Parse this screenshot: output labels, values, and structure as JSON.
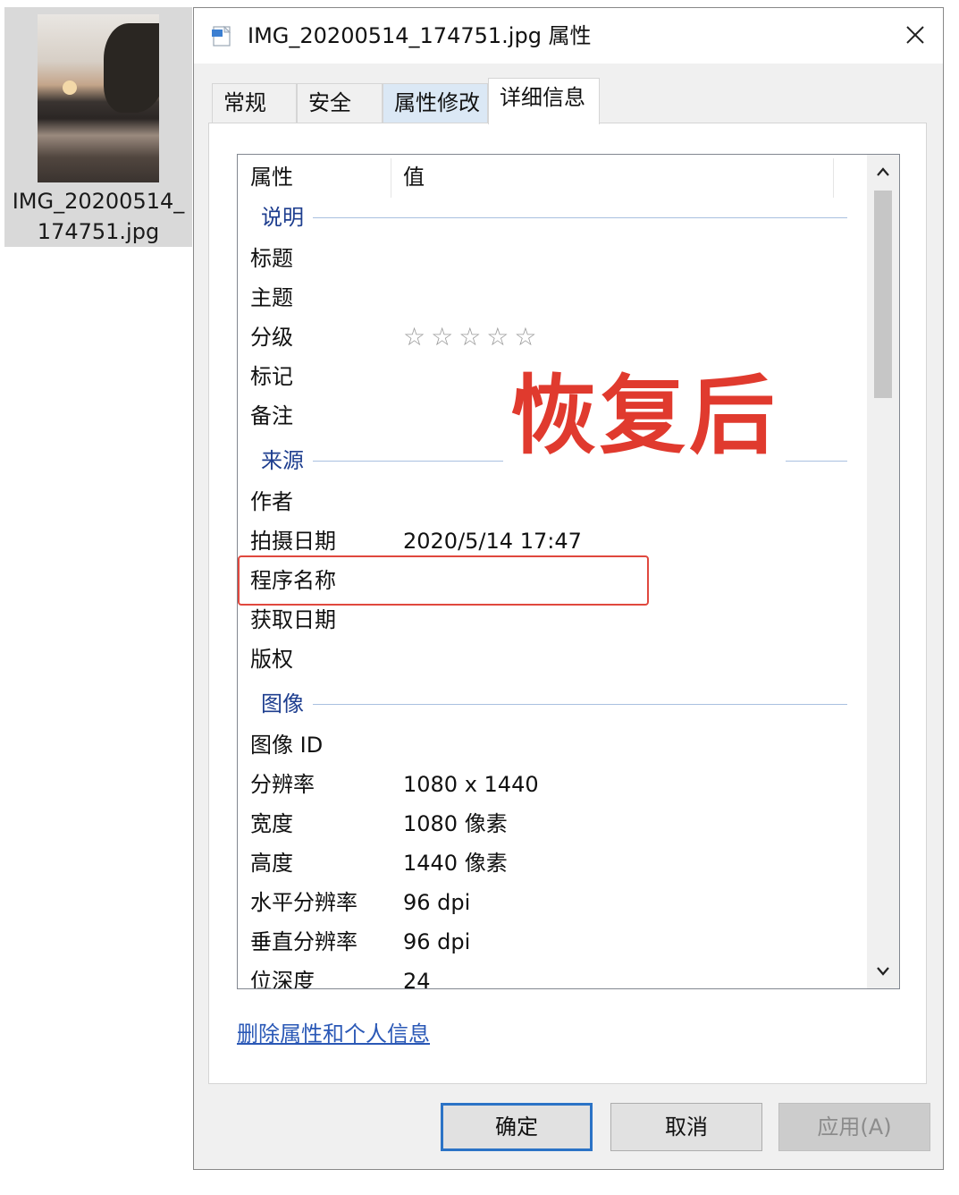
{
  "desktop_file": {
    "name_line1": "IMG_20200514_",
    "name_line2": "174751.jpg"
  },
  "dialog": {
    "title": "IMG_20200514_174751.jpg 属性",
    "tabs": [
      "常规",
      "安全",
      "属性修改",
      "详细信息"
    ],
    "active_tab": "详细信息",
    "columns": {
      "property": "属性",
      "value": "值"
    },
    "groups": {
      "description": "说明",
      "origin": "来源",
      "image": "图像"
    },
    "rows": {
      "title": {
        "name": "标题",
        "value": ""
      },
      "subject": {
        "name": "主题",
        "value": ""
      },
      "rating": {
        "name": "分级",
        "value": "☆☆☆☆☆"
      },
      "tags": {
        "name": "标记",
        "value": ""
      },
      "comments": {
        "name": "备注",
        "value": ""
      },
      "author": {
        "name": "作者",
        "value": ""
      },
      "date_taken": {
        "name": "拍摄日期",
        "value": "2020/5/14 17:47"
      },
      "program": {
        "name": "程序名称",
        "value": ""
      },
      "date_acquired": {
        "name": "获取日期",
        "value": ""
      },
      "copyright": {
        "name": "版权",
        "value": ""
      },
      "image_id": {
        "name": "图像 ID",
        "value": ""
      },
      "dimensions": {
        "name": "分辨率",
        "value": "1080 x 1440"
      },
      "width": {
        "name": "宽度",
        "value": "1080 像素"
      },
      "height": {
        "name": "高度",
        "value": "1440 像素"
      },
      "h_res": {
        "name": "水平分辨率",
        "value": "96 dpi"
      },
      "v_res": {
        "name": "垂直分辨率",
        "value": "96 dpi"
      },
      "bit_depth": {
        "name": "位深度",
        "value": "24"
      }
    },
    "overlay_text": "恢复后",
    "remove_link": "删除属性和个人信息",
    "buttons": {
      "ok": "确定",
      "cancel": "取消",
      "apply": "应用(A)"
    }
  }
}
